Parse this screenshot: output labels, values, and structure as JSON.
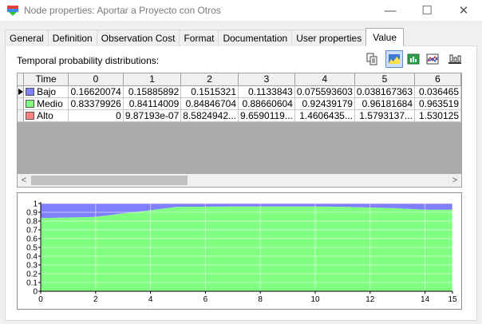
{
  "window": {
    "title": "Node properties: Aportar a Proyecto con Otros",
    "minimize_glyph": "—",
    "maximize_glyph": "☐",
    "close_glyph": "✕"
  },
  "tabs": [
    {
      "label": "General",
      "active": false
    },
    {
      "label": "Definition",
      "active": false
    },
    {
      "label": "Observation Cost",
      "active": false
    },
    {
      "label": "Format",
      "active": false
    },
    {
      "label": "Documentation",
      "active": false
    },
    {
      "label": "User properties",
      "active": false
    },
    {
      "label": "Value",
      "active": true
    }
  ],
  "value_tab": {
    "section_label": "Temporal probability distributions:",
    "toolbar_icons": [
      "copy-icon",
      "area-chart-icon",
      "bar-chart-icon",
      "line-chart-icon",
      "settings-slider-icon"
    ],
    "grid": {
      "header_label": "Time",
      "columns": [
        "0",
        "1",
        "2",
        "3",
        "4",
        "5",
        "6"
      ],
      "rows": [
        {
          "state": "Bajo",
          "color": "#8080ff",
          "current": true,
          "values": [
            "0.16620074",
            "0.15885892",
            "0.1515321",
            "0.1133843",
            "0.075593603",
            "0.038167363",
            "0.036465"
          ]
        },
        {
          "state": "Medio",
          "color": "#80ff80",
          "current": false,
          "values": [
            "0.83379926",
            "0.84114009",
            "0.84846704",
            "0.88660604",
            "0.92439179",
            "0.96181684",
            "0.963519"
          ]
        },
        {
          "state": "Alto",
          "color": "#ff8080",
          "current": false,
          "values": [
            "0",
            "9.87193e-07",
            "8.5824942...",
            "9.6590119...",
            "1.4606435...",
            "1.5793137...",
            "1.530125"
          ]
        }
      ],
      "scroll_left_glyph": "<",
      "scroll_right_glyph": ">"
    }
  },
  "chart_data": {
    "type": "area",
    "stacked": true,
    "x": [
      0,
      1,
      2,
      3,
      4,
      5,
      6,
      7,
      8,
      9,
      10,
      11,
      12,
      13,
      14,
      15
    ],
    "series": [
      {
        "name": "Alto",
        "color": "#ff8080",
        "values": [
          0,
          0,
          0,
          0,
          0,
          0,
          0,
          0,
          0,
          0,
          0,
          0,
          0,
          0,
          0,
          0
        ]
      },
      {
        "name": "Medio",
        "color": "#80ff80",
        "values": [
          0.834,
          0.841,
          0.848,
          0.887,
          0.924,
          0.962,
          0.964,
          0.966,
          0.966,
          0.966,
          0.966,
          0.963,
          0.955,
          0.945,
          0.93,
          0.93
        ]
      },
      {
        "name": "Bajo",
        "color": "#8080ff",
        "values": [
          0.166,
          0.159,
          0.152,
          0.113,
          0.076,
          0.038,
          0.036,
          0.034,
          0.034,
          0.034,
          0.034,
          0.037,
          0.045,
          0.055,
          0.07,
          0.07
        ]
      }
    ],
    "xlim": [
      0,
      15
    ],
    "ylim": [
      0,
      1
    ],
    "x_ticks": [
      "0",
      "2",
      "4",
      "6",
      "8",
      "10",
      "12",
      "14",
      "15"
    ],
    "y_ticks": [
      "0",
      "0.1",
      "0.2",
      "0.3",
      "0.4",
      "0.5",
      "0.6",
      "0.7",
      "0.8",
      "0.9",
      "1"
    ],
    "grid": true,
    "legend": "none",
    "title": "",
    "xlabel": "",
    "ylabel": ""
  }
}
